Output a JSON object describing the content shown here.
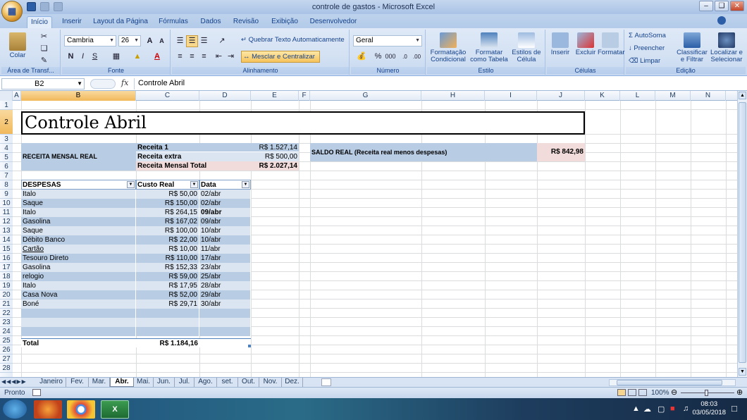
{
  "window": {
    "title": "controle de gastos - Microsoft Excel"
  },
  "tabs": [
    "Início",
    "Inserir",
    "Layout da Página",
    "Fórmulas",
    "Dados",
    "Revisão",
    "Exibição",
    "Desenvolvedor"
  ],
  "ribbon": {
    "clipboard": {
      "paste": "Colar",
      "group": "Área de Transf..."
    },
    "font": {
      "name": "Cambria",
      "size": "26",
      "group": "Fonte",
      "bold": "N",
      "italic": "I",
      "underline": "S"
    },
    "alignment": {
      "wrap": "Quebrar Texto Automaticamente",
      "merge": "Mesclar e Centralizar",
      "group": "Alinhamento"
    },
    "number": {
      "format": "Geral",
      "group": "Número",
      "percent": "%",
      "thousands": "000"
    },
    "styles": {
      "conditional": "Formatação\nCondicional",
      "table": "Formatar\ncomo Tabela",
      "cell": "Estilos de\nCélula",
      "group": "Estilo"
    },
    "cells": {
      "insert": "Inserir",
      "delete": "Excluir",
      "format": "Formatar",
      "group": "Células"
    },
    "editing": {
      "autosum": "AutoSoma",
      "fill": "Preencher",
      "clear": "Limpar",
      "sort": "Classificar\ne Filtrar",
      "find": "Localizar e\nSelecionar",
      "group": "Edição"
    }
  },
  "formula_bar": {
    "name_box": "B2",
    "fx": "fx",
    "content": "Controle Abril"
  },
  "columns": [
    "A",
    "B",
    "C",
    "D",
    "E",
    "F",
    "G",
    "H",
    "I",
    "J",
    "K",
    "L",
    "M",
    "N"
  ],
  "rows": [
    "1",
    "2",
    "3",
    "4",
    "5",
    "6",
    "7",
    "8",
    "9",
    "10",
    "11",
    "12",
    "13",
    "14",
    "15",
    "16",
    "17",
    "18",
    "19",
    "20",
    "21",
    "22",
    "23",
    "24",
    "25",
    "26",
    "27",
    "28"
  ],
  "sheet": {
    "title": "Controle Abril",
    "income_label": "RECEITA MENSAL REAL",
    "income": [
      {
        "label": "Receita 1",
        "value": "R$ 1.527,14"
      },
      {
        "label": "Receita extra",
        "value": "R$ 500,00"
      },
      {
        "label": "Receita Mensal Total",
        "value": "R$ 2.027,14"
      }
    ],
    "balance_label": "SALDO REAL (Receita real menos despesas)",
    "balance_value": "R$ 842,98",
    "expenses_headers": [
      "DESPESAS",
      "Custo Real",
      "Data"
    ],
    "expenses": [
      {
        "name": "Italo",
        "cost": "R$ 50,00",
        "date": "02/abr"
      },
      {
        "name": "Saque",
        "cost": "R$ 150,00",
        "date": "02/abr"
      },
      {
        "name": "Italo",
        "cost": "R$ 264,15",
        "date": "09/abr"
      },
      {
        "name": "Gasolina",
        "cost": "R$ 167,02",
        "date": "09/abr"
      },
      {
        "name": "Saque",
        "cost": "R$ 100,00",
        "date": "10/abr"
      },
      {
        "name": "Débito Banco",
        "cost": "R$ 22,00",
        "date": "10/abr"
      },
      {
        "name": "Cartão",
        "cost": "R$ 10,00",
        "date": "11/abr"
      },
      {
        "name": "Tesouro Direto",
        "cost": "R$ 110,00",
        "date": "17/abr"
      },
      {
        "name": "Gasolina",
        "cost": "R$ 152,33",
        "date": "23/abr"
      },
      {
        "name": "relogio",
        "cost": "R$ 59,00",
        "date": "25/abr"
      },
      {
        "name": "Italo",
        "cost": "R$ 17,95",
        "date": "28/abr"
      },
      {
        "name": "Casa Nova",
        "cost": "R$ 52,00",
        "date": "29/abr"
      },
      {
        "name": "Boné",
        "cost": "R$ 29,71",
        "date": "30/abr"
      }
    ],
    "total_label": "Total",
    "total_value": "R$ 1.184,16"
  },
  "sheet_tabs": [
    "Janeiro",
    "Fev.",
    "Mar.",
    "Abr.",
    "Mai.",
    "Jun.",
    "Jul.",
    "Ago.",
    "set.",
    "Out.",
    "Nov.",
    "Dez."
  ],
  "active_sheet": "Abr.",
  "status": {
    "ready": "Pronto",
    "zoom": "100%"
  },
  "taskbar": {
    "time": "08:03",
    "date": "03/05/2018"
  },
  "colors": {
    "header_blue": "#b8cce4",
    "light_blue": "#dbe5f1",
    "pink": "#f2dcdb",
    "selected_header": "#f1b95b"
  }
}
